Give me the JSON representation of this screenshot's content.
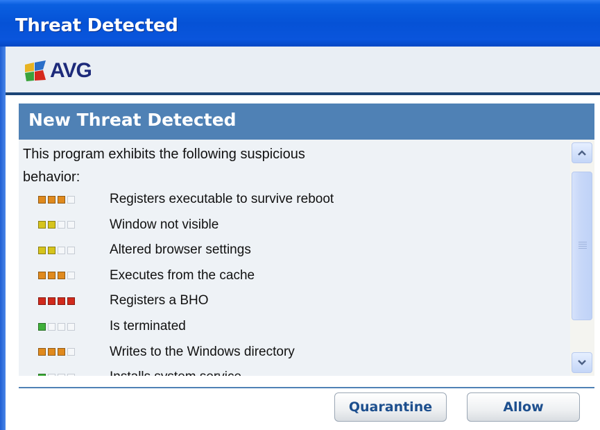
{
  "window": {
    "title": "Threat Detected"
  },
  "brand": {
    "name": "AVG"
  },
  "section": {
    "title": "New Threat Detected"
  },
  "intro": "This program exhibits the following suspicious behavior:",
  "behaviors": [
    {
      "label": "Registers executable to survive reboot",
      "severity": 3,
      "color": "#e08a1e"
    },
    {
      "label": "Window not visible",
      "severity": 2,
      "color": "#d6c41c"
    },
    {
      "label": "Altered browser settings",
      "severity": 2,
      "color": "#d6c41c"
    },
    {
      "label": "Executes from the cache",
      "severity": 3,
      "color": "#e08a1e"
    },
    {
      "label": "Registers a BHO",
      "severity": 4,
      "color": "#d02a1c"
    },
    {
      "label": "Is terminated",
      "severity": 1,
      "color": "#3fb03a"
    },
    {
      "label": "Writes to the Windows directory",
      "severity": 3,
      "color": "#e08a1e"
    },
    {
      "label": "Installs system service",
      "severity": 1,
      "color": "#3fb03a"
    }
  ],
  "buttons": {
    "quarantine": "Quarantine",
    "allow": "Allow"
  },
  "colors": {
    "titlebar": "#0552d6",
    "section_header": "#4f81b5",
    "button_text": "#1d4f8e"
  }
}
